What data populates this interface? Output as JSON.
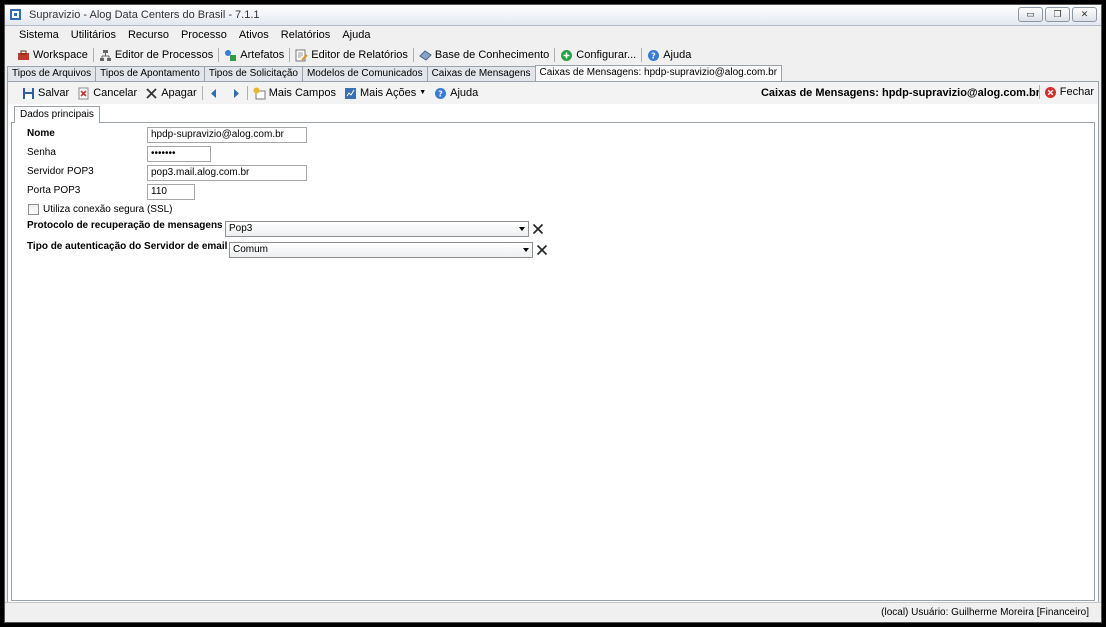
{
  "window": {
    "title": "Supravizio - Alog Data Centers do Brasil - 7.1.1",
    "controls": {
      "minimize": "▭",
      "restore": "❐",
      "close": "✕"
    }
  },
  "menubar": [
    "Sistema",
    "Utilitários",
    "Recurso",
    "Processo",
    "Ativos",
    "Relatórios",
    "Ajuda"
  ],
  "toolbar": {
    "workspace": "Workspace",
    "process_editor": "Editor de Processos",
    "artifacts": "Artefatos",
    "report_editor": "Editor de Relatórios",
    "knowledge_base": "Base de Conhecimento",
    "configure": "Configurar...",
    "help": "Ajuda"
  },
  "doc_tabs": [
    "Tipos de Arquivos",
    "Tipos de Apontamento",
    "Tipos de Solicitação",
    "Modelos de Comunicados",
    "Caixas de Mensagens",
    "Caixas de Mensagens: hpdp-supravizio@alog.com.br"
  ],
  "form_toolbar": {
    "save": "Salvar",
    "cancel": "Cancelar",
    "delete": "Apagar",
    "more_fields": "Mais Campos",
    "more_actions": "Mais Ações",
    "help": "Ajuda",
    "heading": "Caixas de Mensagens: hpdp-supravizio@alog.com.br",
    "close": "Fechar"
  },
  "inner_tab": "Dados principais",
  "form": {
    "name_label": "Nome",
    "name_value": "hpdp-supravizio@alog.com.br",
    "password_label": "Senha",
    "password_value": "•••••••",
    "server_label": "Servidor POP3",
    "server_value": "pop3.mail.alog.com.br",
    "port_label": "Porta POP3",
    "port_value": "110",
    "ssl_label": "Utiliza conexão segura (SSL)",
    "ssl_checked": false,
    "protocol_label": "Protocolo de recuperação de mensagens",
    "protocol_value": "Pop3",
    "auth_label": "Tipo de autenticação do Servidor de email",
    "auth_value": "Comum"
  },
  "status": "(local)  Usuário: Guilherme Moreira [Financeiro]"
}
